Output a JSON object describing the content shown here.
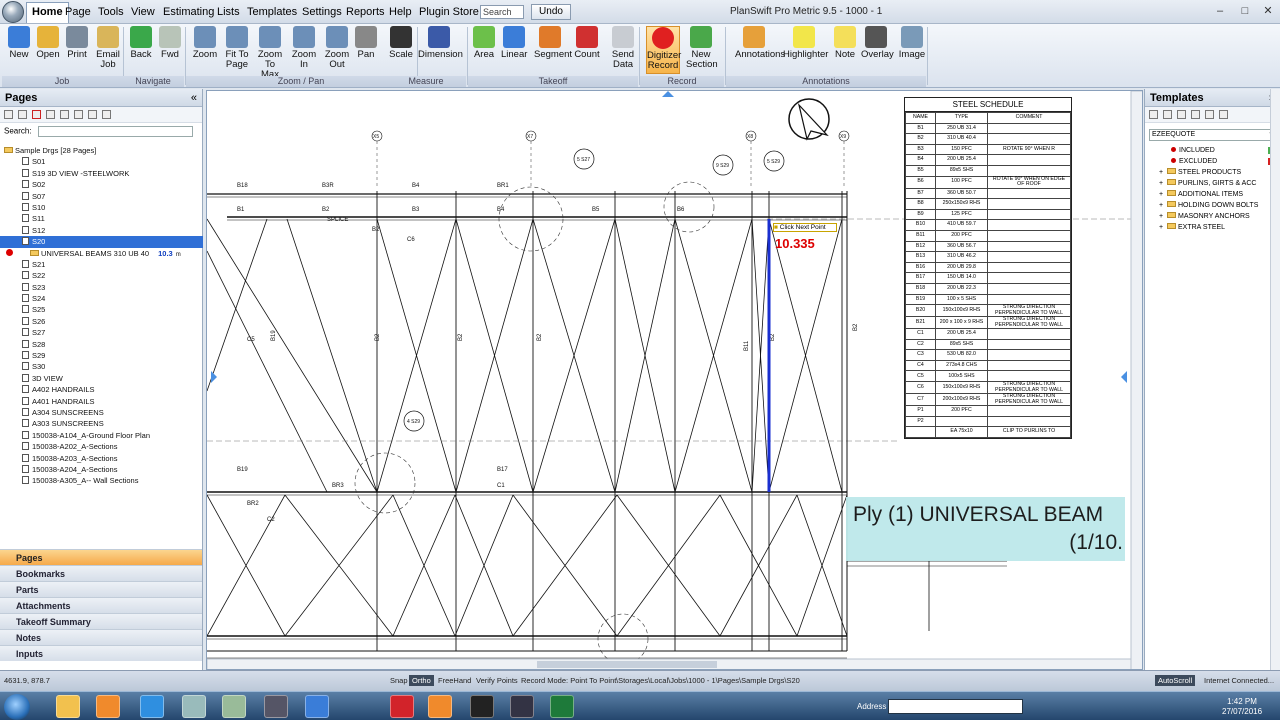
{
  "menu": {
    "items": [
      "Home",
      "Page",
      "Tools",
      "View",
      "Estimating",
      "Lists",
      "Templates",
      "Settings",
      "Reports",
      "Help",
      "Plugin Store"
    ],
    "search_placeholder": "Search",
    "undo": "Undo"
  },
  "app_title": "PlanSwift Pro Metric 9.5 - 1000 - 1",
  "ribbon": {
    "buttons": [
      {
        "label": "New",
        "icon": "new-icon",
        "color": "#3b7dd8"
      },
      {
        "label": "Open",
        "icon": "open-icon",
        "color": "#e6b33a"
      },
      {
        "label": "Print",
        "icon": "print-icon",
        "color": "#7a8a9c"
      },
      {
        "label": "Email Job",
        "icon": "email-icon",
        "color": "#d9b55a"
      },
      {
        "label": "Back",
        "icon": "back-icon",
        "color": "#3aa84a"
      },
      {
        "label": "Fwd",
        "icon": "forward-icon",
        "color": "#b8c4b8"
      },
      {
        "label": "Zoom",
        "icon": "zoom-icon",
        "color": "#6c8fb8"
      },
      {
        "label": "Fit To Page",
        "icon": "fit-page-icon",
        "color": "#6c8fb8"
      },
      {
        "label": "Zoom To Max",
        "icon": "zoom-max-icon",
        "color": "#6c8fb8"
      },
      {
        "label": "Zoom In",
        "icon": "zoom-in-icon",
        "color": "#6c8fb8"
      },
      {
        "label": "Zoom Out",
        "icon": "zoom-out-icon",
        "color": "#6c8fb8"
      },
      {
        "label": "Pan",
        "icon": "pan-icon",
        "color": "#888"
      },
      {
        "label": "Scale",
        "icon": "scale-icon",
        "color": "#333"
      },
      {
        "label": "Dimension",
        "icon": "dimension-icon",
        "color": "#3b5aa8"
      },
      {
        "label": "Area",
        "icon": "area-icon",
        "color": "#6cc04a"
      },
      {
        "label": "Linear",
        "icon": "linear-icon",
        "color": "#3b7dd8"
      },
      {
        "label": "Segment",
        "icon": "segment-icon",
        "color": "#e07a2a"
      },
      {
        "label": "Count",
        "icon": "count-icon",
        "color": "#d03030"
      },
      {
        "label": "Send Data",
        "icon": "send-data-icon",
        "color": "#c8ccd2"
      },
      {
        "label": "Digitizer Record",
        "icon": "record-icon",
        "color": "#e02020"
      },
      {
        "label": "New Section",
        "icon": "new-section-icon",
        "color": "#4aa84a"
      },
      {
        "label": "Annotations",
        "icon": "annotations-icon",
        "color": "#e6a03a"
      },
      {
        "label": "Highlighter",
        "icon": "highlighter-icon",
        "color": "#f2e64a"
      },
      {
        "label": "Note",
        "icon": "note-icon",
        "color": "#f4df5a"
      },
      {
        "label": "Overlay",
        "icon": "overlay-icon",
        "color": "#555"
      },
      {
        "label": "Image",
        "icon": "image-icon",
        "color": "#7a9ab8"
      }
    ],
    "groups": [
      "Job",
      "Navigate",
      "Zoom / Pan",
      "Measure",
      "Takeoff",
      "Record",
      "Annotations"
    ]
  },
  "pages_panel": {
    "title": "Pages",
    "search_label": "Search:",
    "tree": [
      {
        "label": "Sample Drgs [28 Pages]",
        "kind": "folder"
      },
      {
        "label": "S01"
      },
      {
        "label": "S19 3D VIEW -STEELWORK"
      },
      {
        "label": "S02"
      },
      {
        "label": "S07"
      },
      {
        "label": "S10"
      },
      {
        "label": "S11"
      },
      {
        "label": "S12"
      },
      {
        "label": "S20",
        "kind": "selected"
      },
      {
        "label": "UNIVERSAL BEAMS 310 UB 40",
        "value": "10.3",
        "unit": "m",
        "kind": "item"
      },
      {
        "label": "S21"
      },
      {
        "label": "S22"
      },
      {
        "label": "S23"
      },
      {
        "label": "S24"
      },
      {
        "label": "S25"
      },
      {
        "label": "S26"
      },
      {
        "label": "S27"
      },
      {
        "label": "S28"
      },
      {
        "label": "S29"
      },
      {
        "label": "S30"
      },
      {
        "label": "3D VIEW"
      },
      {
        "label": "A402 HANDRAILS"
      },
      {
        "label": "A401 HANDRAILS"
      },
      {
        "label": "A304 SUNSCREENS"
      },
      {
        "label": "A303 SUNSCREENS"
      },
      {
        "label": "150038-A104_A-Ground Floor Plan"
      },
      {
        "label": "150038-A202_A-Sections"
      },
      {
        "label": "150038-A203_A-Sections"
      },
      {
        "label": "150038-A204_A-Sections"
      },
      {
        "label": "150038-A305_A-- Wall Sections"
      }
    ],
    "nav": [
      "Pages",
      "Bookmarks",
      "Parts",
      "Attachments",
      "Takeoff Summary",
      "Notes",
      "Inputs"
    ]
  },
  "drawing": {
    "schedule_title": "STEEL SCHEDULE",
    "schedule_headers": [
      "NAME",
      "TYPE",
      "COMMENT"
    ],
    "schedule_rows": [
      [
        "B1",
        "250 UB 31.4",
        ""
      ],
      [
        "B2",
        "310 UB 40.4",
        ""
      ],
      [
        "B3",
        "150 PFC",
        "ROTATE 90° WHEN R"
      ],
      [
        "B4",
        "200 UB 25.4",
        ""
      ],
      [
        "B5",
        "89x5 SHS",
        ""
      ],
      [
        "B6",
        "100 PFC",
        "ROTATE 90° WHEN ON EDGE OF ROOF"
      ],
      [
        "B7",
        "360 UB 50.7",
        ""
      ],
      [
        "B8",
        "250x150x9 RHS",
        ""
      ],
      [
        "B9",
        "125 PFC",
        ""
      ],
      [
        "B10",
        "410 UB 59.7",
        ""
      ],
      [
        "B11",
        "200 PFC",
        ""
      ],
      [
        "B12",
        "360 UB 56.7",
        ""
      ],
      [
        "B13",
        "310 UB 46.2",
        ""
      ],
      [
        "B16",
        "200 UB 29.8",
        ""
      ],
      [
        "B17",
        "150 UB 14.0",
        ""
      ],
      [
        "B18",
        "200 UB 22.3",
        ""
      ],
      [
        "B19",
        "100 x 5 SHS",
        ""
      ],
      [
        "B20",
        "150x100x9 RHS",
        "STRONG DIRECTION PERPENDICULAR TO WALL"
      ],
      [
        "B21",
        "200 x 100 x 9 RHS",
        "STRONG DIRECTION PERPENDICULAR TO WALL"
      ],
      [
        "C1",
        "200 UB 25.4",
        ""
      ],
      [
        "C2",
        "89x5 SHS",
        ""
      ],
      [
        "C3",
        "530 UB 82.0",
        ""
      ],
      [
        "C4",
        "273x4.8 CHS",
        ""
      ],
      [
        "C5",
        "100x5 SHS",
        ""
      ],
      [
        "C6",
        "150x100x9 RHS",
        "STRONG DIRECTION PERPENDICULAR TO WALL"
      ],
      [
        "C7",
        "200x100x9 RHS",
        "STRONG DIRECTION PERPENDICULAR TO WALL"
      ],
      [
        "P1",
        "200 PFC",
        ""
      ],
      [
        "P2",
        "",
        ""
      ],
      [
        "",
        "EA 75x10",
        "CLIP TO PURLINS TO"
      ]
    ],
    "grid_labels": [
      "X5",
      "X7",
      "X8",
      "X9"
    ],
    "callouts": [
      "5 S27",
      "9 S29",
      "5 S29",
      "4 S29"
    ],
    "beam_labels": [
      "B1",
      "B2",
      "B3",
      "B4",
      "B5",
      "B6",
      "B18",
      "B3R",
      "B4",
      "BR1",
      "BR2",
      "BR3",
      "C1",
      "C2",
      "C5",
      "C6",
      "B17",
      "B19",
      "B2",
      "SPLICE"
    ],
    "tooltip": "Click Next Point",
    "measure_value": "10.335",
    "ply_label_line1": "Ply (1) UNIVERSAL BEAM",
    "ply_label_line2": "(1/10."
  },
  "templates_panel": {
    "title": "Templates",
    "dropdown": "EZEEQUOTE",
    "items": [
      {
        "label": "INCLUDED",
        "color": "#4caf50"
      },
      {
        "label": "EXCLUDED",
        "color": "#d62020"
      },
      {
        "label": "STEEL PRODUCTS"
      },
      {
        "label": "PURLINS, GIRTS & ACC"
      },
      {
        "label": "ADDITIONAL ITEMS"
      },
      {
        "label": "HOLDING DOWN BOLTS"
      },
      {
        "label": "MASONRY ANCHORS"
      },
      {
        "label": "EXTRA STEEL"
      }
    ]
  },
  "status": {
    "coords": "4631.9, 878.7",
    "snap": "Snap",
    "ortho": "Ortho",
    "freehand": "FreeHand",
    "verify": "Verify Points",
    "record_mode": "Record Mode: Point To Point",
    "path": "\\Storages\\Local\\Jobs\\1000 - 1\\Pages\\Sample Drgs\\S20",
    "autoscroll": "AutoScroll",
    "internet": "Internet Connected..."
  },
  "taskbar": {
    "address_label": "Address",
    "time": "1:42 PM",
    "date": "27/07/2016"
  }
}
